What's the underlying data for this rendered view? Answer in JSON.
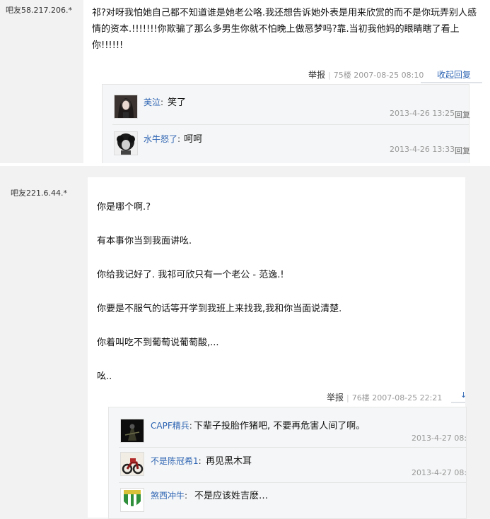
{
  "posts": [
    {
      "author": "吧友58.217.206.*",
      "content": "祁?对呀我怕她自己都不知道谁是她老公咯.我还想告诉她外表是用来欣赏的而不是你玩弄别人感情的资本.!!!!!!!你欺骗了那么多男生你就不怕晚上做恶梦吗?靠.当初我他妈的眼睛瞎了看上你!!!!!!",
      "report": "举报",
      "floor": "75楼",
      "time": "2007-08-25 08:10",
      "collapse": "收起回复",
      "replies": [
        {
          "user": "芙泣",
          "colon": ":",
          "text": "笑了",
          "time": "2013-4-26 13:25",
          "reply": "回复",
          "avatar": "dark-portrait"
        },
        {
          "user": "水牛怒了",
          "colon": ":",
          "text": "呵呵",
          "time": "2013-4-26 13:33",
          "reply": "回复",
          "avatar": "curly-hair-portrait"
        }
      ]
    },
    {
      "author": "吧友221.6.44.*",
      "paragraphs": [
        "你是哪个啊.?",
        "有本事你当到我面讲吆.",
        "你给我记好了. 我祁可欣只有一个老公 - 范逸.!",
        "你要是不服气的话等开学到我班上来找我,我和你当面说清楚.",
        "你着叫吃不到葡萄说葡萄酸,...",
        "吆.."
      ],
      "report": "举报",
      "floor": "76楼",
      "time": "2007-08-25 22:21",
      "collapse": "↓",
      "replies": [
        {
          "user": "CAPF精兵",
          "colon": ":",
          "text": "下辈子投胎作猪吧, 不要再危害人间了啊。",
          "time": "2013-4-27 08:",
          "reply": "",
          "avatar": "dark-figure"
        },
        {
          "user": "不是陈冠希1",
          "colon": ":",
          "text": "再见黑木耳",
          "time": "2013-4-27 08:",
          "reply": "",
          "avatar": "motorcycle"
        },
        {
          "user": "煞西冲牛",
          "colon": ":",
          "text": "不是应该姓吉麽…",
          "time": "",
          "reply": "",
          "avatar": "team-badge"
        }
      ]
    }
  ],
  "colors": {
    "link": "#2d64b3",
    "meta": "#999999",
    "panel": "#f5f6f7",
    "background": "#f2f2f2"
  }
}
